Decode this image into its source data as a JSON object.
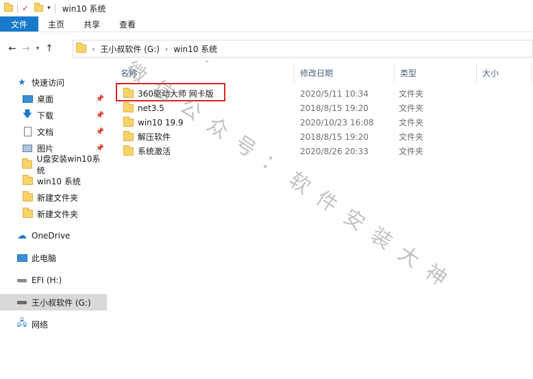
{
  "window": {
    "title": "win10 系统"
  },
  "ribbon": {
    "tabs": [
      "文件",
      "主页",
      "共享",
      "查看"
    ]
  },
  "address": {
    "crumbs": [
      "王小叔软件 (G:)",
      "win10 系统"
    ]
  },
  "nav": {
    "quick_access": "快速访问",
    "items": [
      {
        "label": "桌面",
        "icon": "desktop-icon",
        "pinned": true
      },
      {
        "label": "下载",
        "icon": "download-icon",
        "pinned": true
      },
      {
        "label": "文档",
        "icon": "document-icon",
        "pinned": true
      },
      {
        "label": "图片",
        "icon": "picture-icon",
        "pinned": true
      },
      {
        "label": "U盘安装win10系统",
        "icon": "folder-icon"
      },
      {
        "label": "win10 系统",
        "icon": "folder-icon"
      },
      {
        "label": "新建文件夹",
        "icon": "folder-icon"
      },
      {
        "label": "新建文件夹",
        "icon": "folder-icon"
      }
    ],
    "onedrive": "OneDrive",
    "this_pc": "此电脑",
    "efi": "EFI (H:)",
    "drive_g": "王小叔软件 (G:)",
    "network": "网络"
  },
  "columns": {
    "name": "名称",
    "date": "修改日期",
    "type": "类型",
    "size": "大小"
  },
  "files": [
    {
      "name": "360驱动大师 网卡版",
      "date": "2020/5/11 10:34",
      "type": "文件夹"
    },
    {
      "name": "net3.5",
      "date": "2018/8/15 19:20",
      "type": "文件夹"
    },
    {
      "name": "win10 19.9",
      "date": "2020/10/23 16:08",
      "type": "文件夹"
    },
    {
      "name": "解压软件",
      "date": "2018/8/15 19:20",
      "type": "文件夹"
    },
    {
      "name": "系统激活",
      "date": "2020/8/26 20:33",
      "type": "文件夹"
    }
  ],
  "watermark": "微信公众号：软件安装大神",
  "colors": {
    "accent": "#1979ca",
    "highlight": "#e02020",
    "folder": "#f8d36a"
  }
}
